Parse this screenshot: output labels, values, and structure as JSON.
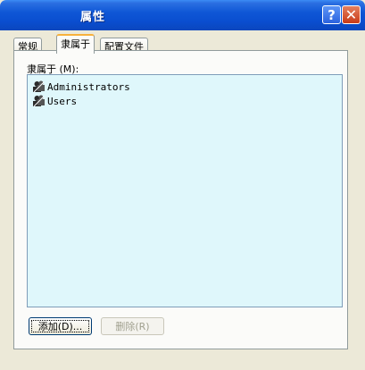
{
  "window": {
    "title": "属性"
  },
  "tabs": [
    {
      "label": "常规"
    },
    {
      "label": "隶属于"
    },
    {
      "label": "配置文件"
    }
  ],
  "member_of": {
    "label": "隶属于 (M):",
    "items": [
      {
        "name": "Administrators",
        "icon": "group-icon"
      },
      {
        "name": "Users",
        "icon": "group-icon"
      }
    ]
  },
  "buttons": {
    "add": "添加(D)...",
    "remove": "删除(R)"
  },
  "colors": {
    "titlebar": "#0a4ed0",
    "listbox_bg": "#dff7fb",
    "active_tab_accent": "#f7b13c"
  }
}
